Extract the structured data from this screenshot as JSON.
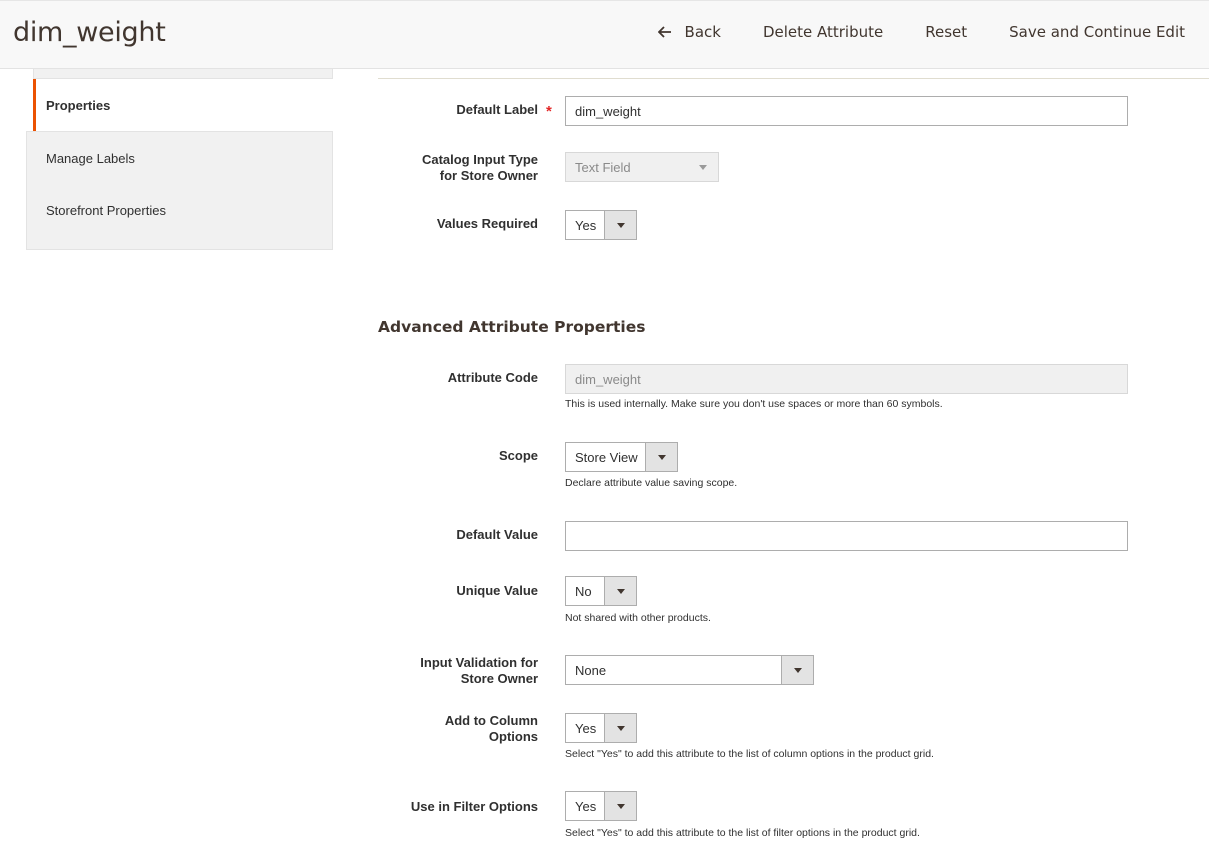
{
  "header": {
    "title": "dim_weight",
    "back_label": "Back",
    "delete_label": "Delete Attribute",
    "reset_label": "Reset",
    "save_continue_label": "Save and Continue Edit"
  },
  "sidebar": {
    "active_tab": "Properties",
    "items": [
      {
        "label": "Manage Labels"
      },
      {
        "label": "Storefront Properties"
      }
    ]
  },
  "properties": {
    "default_label": {
      "label": "Default Label",
      "value": "dim_weight"
    },
    "input_type": {
      "label_line1": "Catalog Input Type",
      "label_line2": "for Store Owner",
      "value": "Text Field"
    },
    "values_required": {
      "label": "Values Required",
      "value": "Yes"
    }
  },
  "advanced": {
    "title": "Advanced Attribute Properties",
    "attribute_code": {
      "label": "Attribute Code",
      "value": "dim_weight",
      "note": "This is used internally. Make sure you don't use spaces or more than 60 symbols."
    },
    "scope": {
      "label": "Scope",
      "value": "Store View",
      "note": "Declare attribute value saving scope."
    },
    "default_value": {
      "label": "Default Value",
      "value": ""
    },
    "unique_value": {
      "label": "Unique Value",
      "value": "No",
      "note": "Not shared with other products."
    },
    "input_validation": {
      "label_line1": "Input Validation for",
      "label_line2": "Store Owner",
      "value": "None"
    },
    "add_to_column": {
      "label_line1": "Add to Column",
      "label_line2": "Options",
      "value": "Yes",
      "note": "Select \"Yes\" to add this attribute to the list of column options in the product grid."
    },
    "use_in_filter": {
      "label": "Use in Filter Options",
      "value": "Yes",
      "note": "Select \"Yes\" to add this attribute to the list of filter options in the product grid."
    }
  },
  "colors": {
    "accent": "#eb5202",
    "required": "#e22626",
    "text": "#303030"
  },
  "icons": {
    "back": "arrow-left-icon",
    "dropdown": "caret-down-icon"
  }
}
